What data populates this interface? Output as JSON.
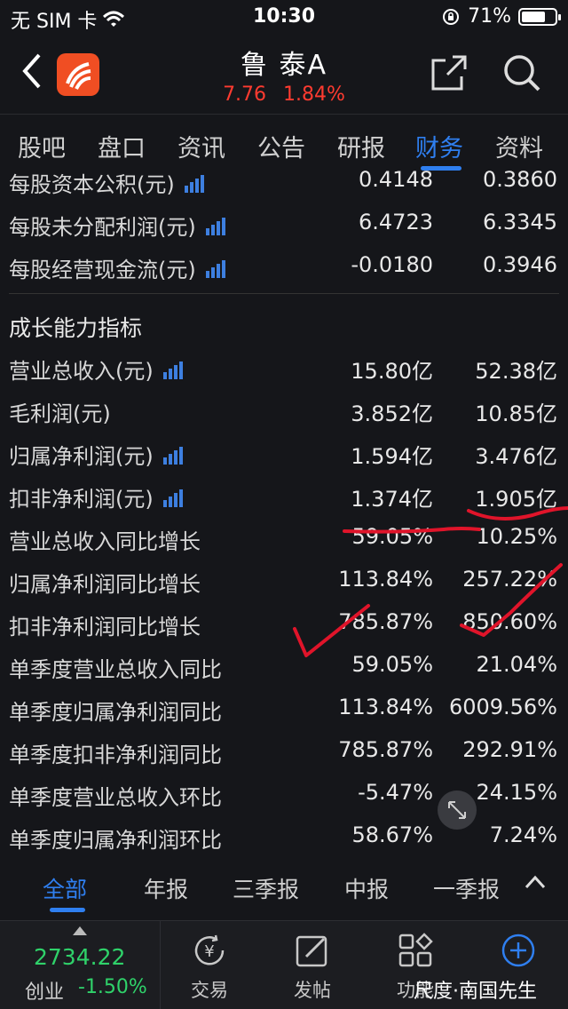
{
  "status_bar": {
    "carrier": "无 SIM 卡",
    "time": "10:30",
    "battery": "71%",
    "battery_level": 0.71
  },
  "header": {
    "title": "鲁  泰A",
    "price": "7.76",
    "change": "1.84%"
  },
  "tabs": [
    {
      "label": "股吧"
    },
    {
      "label": "盘口"
    },
    {
      "label": "资讯"
    },
    {
      "label": "公告"
    },
    {
      "label": "研报"
    },
    {
      "label": "财务"
    },
    {
      "label": "资料"
    }
  ],
  "rows_top": [
    {
      "label": "每股资本公积(元)",
      "v1": "0.4148",
      "v2": "0.3860"
    },
    {
      "label": "每股未分配利润(元)",
      "v1": "6.4723",
      "v2": "6.3345"
    },
    {
      "label": "每股经营现金流(元)",
      "v1": "-0.0180",
      "v2": "0.3946"
    }
  ],
  "section_title": "成长能力指标",
  "rows_growth": [
    {
      "label": "营业总收入(元)",
      "v1": "15.80亿",
      "v2": "52.38亿"
    },
    {
      "label": "毛利润(元)",
      "v1": "3.852亿",
      "v2": "10.85亿"
    },
    {
      "label": "归属净利润(元)",
      "v1": "1.594亿",
      "v2": "3.476亿"
    },
    {
      "label": "扣非净利润(元)",
      "v1": "1.374亿",
      "v2": "1.905亿"
    },
    {
      "label": "营业总收入同比增长",
      "v1": "59.05%",
      "v2": "10.25%"
    },
    {
      "label": "归属净利润同比增长",
      "v1": "113.84%",
      "v2": "257.22%"
    },
    {
      "label": "扣非净利润同比增长",
      "v1": "785.87%",
      "v2": "850.60%"
    },
    {
      "label": "单季度营业总收入同比",
      "v1": "59.05%",
      "v2": "21.04%"
    },
    {
      "label": "单季度归属净利润同比",
      "v1": "113.84%",
      "v2": "6009.56%"
    },
    {
      "label": "单季度扣非净利润同比",
      "v1": "785.87%",
      "v2": "292.91%"
    },
    {
      "label": "单季度营业总收入环比",
      "v1": "-5.47%",
      "v2": "24.15%"
    },
    {
      "label": "单季度归属净利润环比",
      "v1": "58.67%",
      "v2": "7.24%"
    }
  ],
  "report_tabs": [
    {
      "label": "全部"
    },
    {
      "label": "年报"
    },
    {
      "label": "三季报"
    },
    {
      "label": "中报"
    },
    {
      "label": "一季报"
    }
  ],
  "tab_bar": {
    "index_value": "2734.22",
    "index_name": "创业",
    "index_change": "-1.50%",
    "items": [
      {
        "label": "交易"
      },
      {
        "label": "发帖"
      },
      {
        "label": "功能"
      }
    ]
  },
  "watermark": "尺度·南国先生",
  "colors": {
    "accent": "#2f7ff0",
    "up": "#ff3b30",
    "down": "#2fd26a",
    "annotation": "#e0142a"
  }
}
